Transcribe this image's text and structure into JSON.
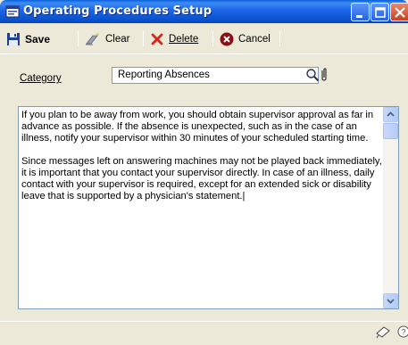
{
  "window": {
    "title": "Operating Procedures Setup",
    "title_bar_color": "#0B53D0",
    "controls": [
      "minimize",
      "maximize",
      "close"
    ]
  },
  "toolbar": {
    "save_label": "Save",
    "clear_label": "Clear",
    "delete_label": "Delete",
    "cancel_label": "Cancel",
    "icons": {
      "save": "floppy-disk-icon",
      "clear": "eraser-icon",
      "delete": "red-x-icon",
      "cancel": "cancel-circle-icon"
    }
  },
  "form": {
    "category_label": "Category",
    "category_value": "Reporting Absences",
    "category_icons": [
      "lookup-magnifier-icon",
      "note-paperclip-icon"
    ]
  },
  "procedure_text": {
    "paragraphs": [
      "If you plan to be away from work, you should obtain supervisor approval as far in advance as possible. If the absence is unexpected, such as in the case of an illness, notify your supervisor within 30 minutes of your scheduled starting time.",
      "Since messages left on answering machines may not be played back immediately, it is important that you contact your supervisor directly. In case of an illness, daily contact with your supervisor is required, except for an extended sick or disability leave that is supported by a physician's statement.|"
    ]
  },
  "status_bar": {
    "icons": [
      "window-note-icon",
      "help-icon"
    ]
  }
}
